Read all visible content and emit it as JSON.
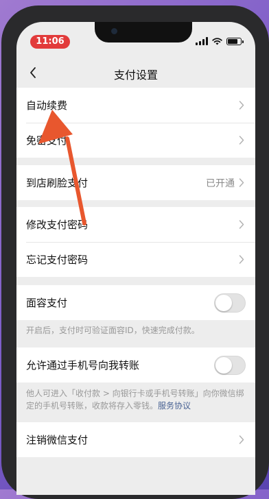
{
  "status_bar": {
    "time": "11:06",
    "time_color": "#e23b3b"
  },
  "nav": {
    "title": "支付设置"
  },
  "groups": {
    "renew": {
      "auto_renew": "自动续费",
      "no_pwd_pay": "免密支付"
    },
    "face_scan": {
      "label": "到店刷脸支付",
      "value": "已开通"
    },
    "password": {
      "modify": "修改支付密码",
      "forgot": "忘记支付密码"
    },
    "face_id": {
      "label": "面容支付",
      "toggle_on": false,
      "note": "开启后，支付时可验证面容ID，快速完成付款。"
    },
    "transfer": {
      "label": "允许通过手机号向我转账",
      "toggle_on": false,
      "note": "他人可进入「收付款 > 向银行卡或手机号转账」向你微信绑定的手机号转账，收款将存入零钱。",
      "link": "服务协议"
    },
    "cancel": {
      "label": "注销微信支付"
    }
  },
  "colors": {
    "arrow": "#e8572e",
    "link": "#4a6394",
    "background": "#ededed"
  },
  "icons": {
    "back": "chevron-left-icon",
    "row_arrow": "chevron-right-icon"
  }
}
